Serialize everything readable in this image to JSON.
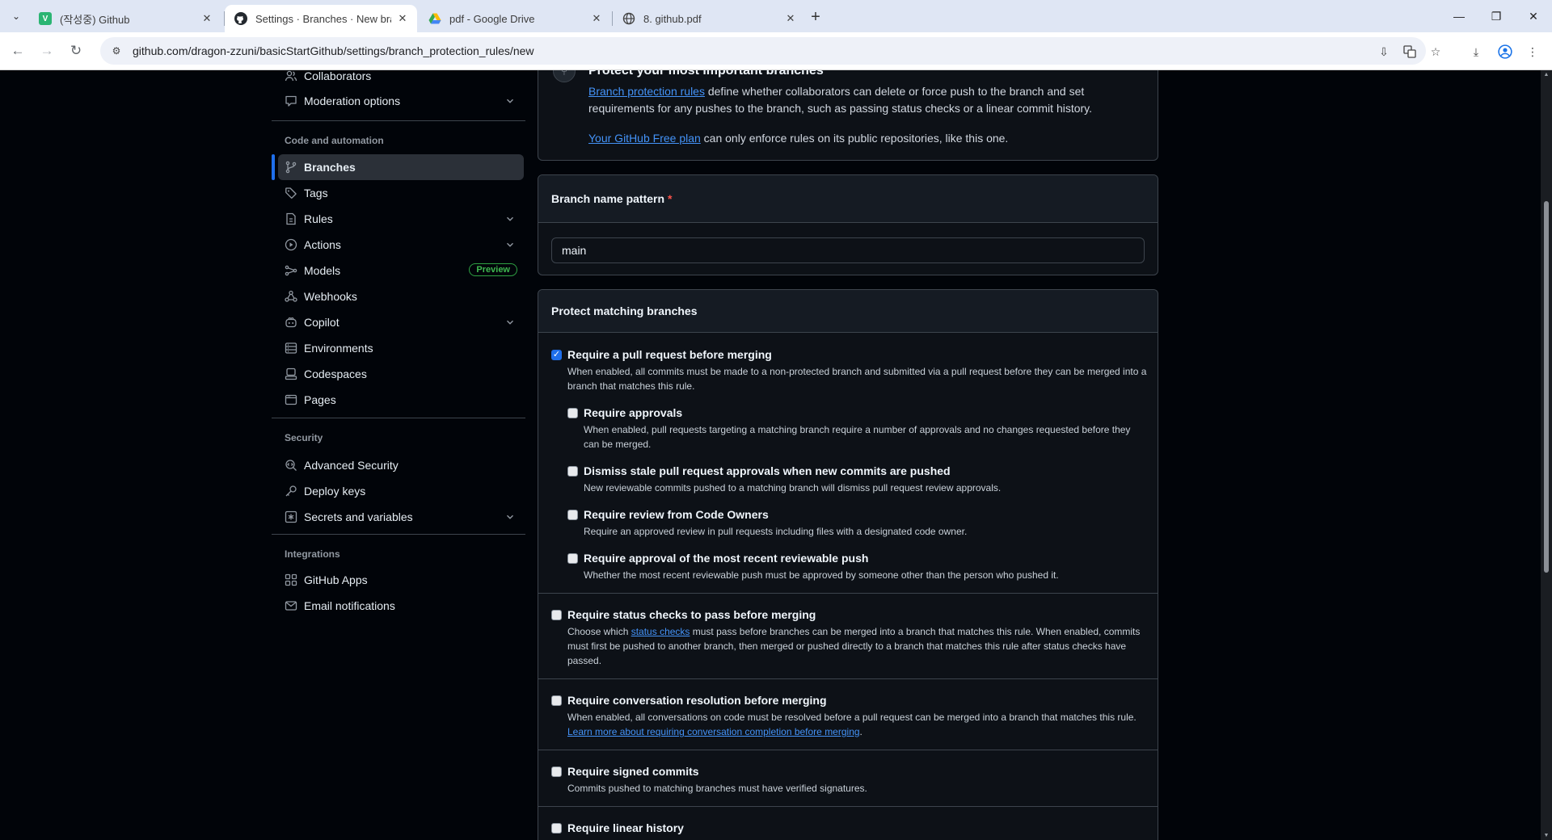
{
  "browser": {
    "tabs": [
      {
        "title": "(작성중) Github",
        "favicon": "v-icon",
        "active": false
      },
      {
        "title": "Settings · Branches · New branch protection rule",
        "favicon": "github-icon",
        "active": true
      },
      {
        "title": "pdf - Google Drive",
        "favicon": "drive-icon",
        "active": false
      },
      {
        "title": "8. github.pdf",
        "favicon": "globe-icon",
        "active": false
      }
    ],
    "url": "github.com/dragon-zzuni/basicStartGithub/settings/branch_protection_rules/new"
  },
  "sidebar": {
    "top_items": [
      {
        "label": "Collaborators",
        "icon": "people-icon"
      },
      {
        "label": "Moderation options",
        "icon": "comment-icon",
        "expandable": true
      }
    ],
    "code_heading": "Code and automation",
    "code_items": [
      {
        "label": "Branches",
        "icon": "branch-icon",
        "selected": true
      },
      {
        "label": "Tags",
        "icon": "tag-icon"
      },
      {
        "label": "Rules",
        "icon": "rules-icon",
        "expandable": true
      },
      {
        "label": "Actions",
        "icon": "play-icon",
        "expandable": true
      },
      {
        "label": "Models",
        "icon": "models-icon",
        "badge": "Preview"
      },
      {
        "label": "Webhooks",
        "icon": "webhook-icon"
      },
      {
        "label": "Copilot",
        "icon": "copilot-icon",
        "expandable": true
      },
      {
        "label": "Environments",
        "icon": "server-icon"
      },
      {
        "label": "Codespaces",
        "icon": "codespaces-icon"
      },
      {
        "label": "Pages",
        "icon": "browser-icon"
      }
    ],
    "security_heading": "Security",
    "security_items": [
      {
        "label": "Advanced Security",
        "icon": "codescan-icon"
      },
      {
        "label": "Deploy keys",
        "icon": "key-icon"
      },
      {
        "label": "Secrets and variables",
        "icon": "asterisk-icon",
        "expandable": true
      }
    ],
    "integrations_heading": "Integrations",
    "integration_items": [
      {
        "label": "GitHub Apps",
        "icon": "apps-icon"
      },
      {
        "label": "Email notifications",
        "icon": "mail-icon"
      }
    ]
  },
  "protect_info": {
    "title": "Protect your most important branches",
    "link1": "Branch protection rules",
    "text1": " define whether collaborators can delete or force push to the branch and set requirements for any pushes to the branch, such as passing status checks or a linear commit history.",
    "link2": "Your GitHub Free plan",
    "text2": " can only enforce rules on its public repositories, like this one."
  },
  "branch_pattern": {
    "label": "Branch name pattern",
    "required_mark": "*",
    "value": "main"
  },
  "protect_section": {
    "header": "Protect matching branches",
    "pr": {
      "label": "Require a pull request before merging",
      "desc": "When enabled, all commits must be made to a non-protected branch and submitted via a pull request before they can be merged into a branch that matches this rule.",
      "checked": true
    },
    "sub_options": [
      {
        "label": "Require approvals",
        "desc": "When enabled, pull requests targeting a matching branch require a number of approvals and no changes requested before they can be merged.",
        "checked": false
      },
      {
        "label": "Dismiss stale pull request approvals when new commits are pushed",
        "desc": "New reviewable commits pushed to a matching branch will dismiss pull request review approvals.",
        "checked": false
      },
      {
        "label": "Require review from Code Owners",
        "desc": "Require an approved review in pull requests including files with a designated code owner.",
        "checked": false
      },
      {
        "label": "Require approval of the most recent reviewable push",
        "desc": "Whether the most recent reviewable push must be approved by someone other than the person who pushed it.",
        "checked": false
      }
    ],
    "status_checks": {
      "label": "Require status checks to pass before merging",
      "desc_before": "Choose which ",
      "desc_link": "status checks",
      "desc_after": " must pass before branches can be merged into a branch that matches this rule. When enabled, commits must first be pushed to another branch, then merged or pushed directly to a branch that matches this rule after status checks have passed.",
      "checked": false
    },
    "conversation": {
      "label": "Require conversation resolution before merging",
      "desc": "When enabled, all conversations on code must be resolved before a pull request can be merged into a branch that matches this rule.",
      "link": "Learn more about requiring conversation completion before merging",
      "link_suffix": ".",
      "checked": false
    },
    "signed": {
      "label": "Require signed commits",
      "desc": "Commits pushed to matching branches must have verified signatures.",
      "checked": false
    },
    "linear": {
      "label": "Require linear history",
      "checked": false
    }
  }
}
